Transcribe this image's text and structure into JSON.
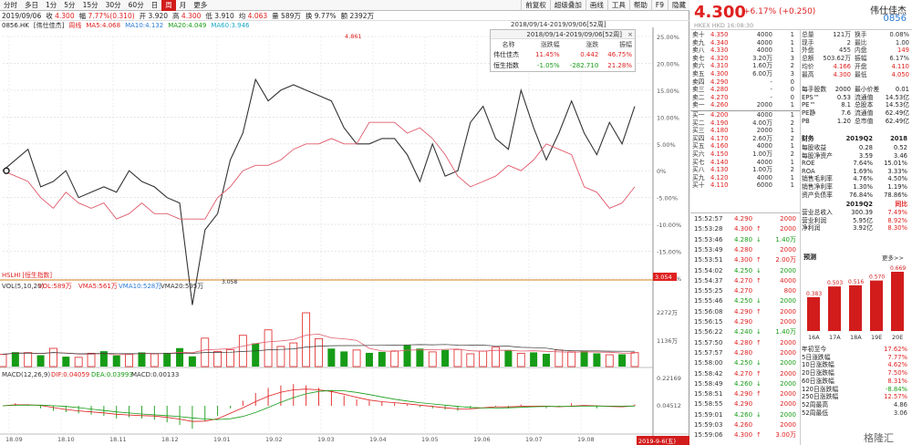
{
  "toolbar": {
    "tabs": [
      "分时",
      "多日",
      "1分",
      "5分",
      "15分",
      "30分",
      "60分",
      "日",
      "周",
      "月",
      "更多"
    ],
    "active": "周",
    "right": [
      "前复权",
      "超级叠加",
      "画线",
      "工具",
      "帮助",
      "F9",
      "隐藏"
    ]
  },
  "ohlc": {
    "date": "2019/09/06",
    "close_label": "收",
    "close": "4.300",
    "chg_label": "幅",
    "chg": "7.77%(0.310)",
    "open_label": "开",
    "open": "3.920",
    "high_label": "高",
    "high": "4.300",
    "low_label": "低",
    "low": "3.910",
    "avg_label": "均",
    "avg": "4.063",
    "vol_label": "量",
    "vol": "589万",
    "turn_label": "换",
    "turn": "9.77%",
    "amt_label": "额",
    "amt": "2392万"
  },
  "ma": {
    "code": "0856.HK",
    "name": "[伟仕佳杰]",
    "period": "周线",
    "ma5": "MA5:4.068",
    "ma10": "MA10:4.132",
    "ma20": "MA20:4.049",
    "ma60": "MA60:3.946"
  },
  "range_label": "2018/09/14-2019/09/06[52周]",
  "price_tag_top": "4.861",
  "price_tag_low": "3.058",
  "price_bar_right": "3.054",
  "index_label": "HSLHI [恒生指数]",
  "y_axis": [
    "25.00%",
    "20.00%",
    "15.00%",
    "10.00%",
    "5.00%",
    "0%",
    "-5.00%",
    "-10.00%",
    "-15.00%",
    "-20.00%"
  ],
  "overlay": {
    "title": "2018/09/14-2019/09/06[52周]",
    "headers": [
      "名称",
      "涨跌幅",
      "涨跌",
      "振幅"
    ],
    "rows": [
      [
        "伟仕佳杰",
        "11.45%",
        "0.442",
        "46.75%"
      ],
      [
        "恒生指数",
        "-1.05%",
        "-282.710",
        "21.28%"
      ]
    ]
  },
  "vol": {
    "label": "VOL(5,10,20)",
    "vol": "VOL:589万",
    "vma5": "VMA5:561万",
    "vma10": "VMA10:528万",
    "vma20": "VMA20:595万",
    "y": [
      "2272万",
      "1136万"
    ]
  },
  "macd": {
    "label": "MACD(12,26,9)",
    "dif": "DIF:0.04059",
    "dea": "DEA:0.03993",
    "macd": "MACD:0.00133",
    "y": [
      "0.22169",
      "0.04512"
    ]
  },
  "x_axis": [
    "18.09",
    "18.10",
    "18.11",
    "18.12",
    "19.01",
    "19.02",
    "19.03",
    "19.04",
    "19.05",
    "19.06",
    "19.07",
    "19.08"
  ],
  "x_end": "2019-9-6(五)",
  "chart_data": {
    "type": "line",
    "series": [
      {
        "name": "伟仕佳杰",
        "values": [
          0,
          2,
          4,
          -3,
          -2,
          0,
          -5,
          -4,
          -3,
          -4,
          0,
          -2,
          -3,
          -5,
          -6,
          -25,
          -11,
          -8,
          2,
          7,
          17,
          13,
          15,
          16,
          15,
          14,
          13,
          8,
          5,
          5,
          6,
          6,
          3,
          -2,
          5,
          -1,
          0,
          9,
          12,
          6,
          4,
          15,
          8,
          2,
          7,
          13,
          7,
          3,
          9,
          5,
          12
        ],
        "color": "#333333"
      },
      {
        "name": "恒生指数",
        "values": [
          0,
          -1,
          -2,
          -5,
          -7,
          -4,
          -6,
          -7,
          -6,
          -9,
          -8,
          -6,
          -8,
          -8,
          -9,
          -9,
          -9,
          -5,
          -3,
          0,
          1,
          1,
          2,
          4,
          5,
          5,
          6,
          5,
          5,
          9,
          9,
          9,
          7,
          8,
          6,
          3,
          -1,
          -3,
          -2,
          -1,
          1,
          0,
          2,
          5,
          4,
          3,
          -3,
          -4,
          -7,
          -6,
          -3
        ],
        "color": "#e05a6a"
      }
    ],
    "ylim": [
      -20,
      25
    ]
  },
  "vol_data": [
    520,
    610,
    590,
    480,
    770,
    420,
    390,
    560,
    650,
    470,
    520,
    600,
    540,
    580,
    780,
    430,
    1200,
    640,
    720,
    1320,
    980,
    1550,
    850,
    1000,
    2272,
    1180,
    760,
    640,
    700,
    580,
    620,
    660,
    900,
    760,
    620,
    700,
    720,
    540,
    650,
    820,
    700,
    560,
    600,
    540,
    700,
    620,
    650,
    560,
    500,
    520,
    589
  ],
  "vol_up": [
    1,
    0,
    1,
    0,
    1,
    0,
    1,
    1,
    0,
    0,
    1,
    0,
    1,
    0,
    0,
    0,
    1,
    1,
    1,
    1,
    0,
    1,
    1,
    1,
    1,
    1,
    0,
    0,
    1,
    0,
    0,
    1,
    0,
    0,
    1,
    0,
    1,
    1,
    1,
    1,
    0,
    1,
    0,
    0,
    1,
    1,
    0,
    0,
    1,
    0,
    1
  ],
  "macd_data": [
    0.0,
    0.02,
    0.01,
    -0.02,
    -0.04,
    -0.05,
    -0.06,
    -0.07,
    -0.08,
    -0.1,
    -0.09,
    -0.1,
    -0.11,
    -0.13,
    -0.15,
    -0.18,
    -0.12,
    -0.08,
    -0.02,
    0.04,
    0.1,
    0.14,
    0.16,
    0.17,
    0.16,
    0.14,
    0.12,
    0.08,
    0.05,
    0.04,
    0.03,
    0.02,
    0.01,
    -0.01,
    -0.02,
    -0.03,
    -0.04,
    -0.02,
    0.0,
    -0.01,
    -0.02,
    0.01,
    0.0,
    -0.02,
    -0.01,
    0.02,
    0.0,
    -0.02,
    0.0,
    -0.01,
    0.01
  ],
  "quote": {
    "price": "4.300",
    "change": "+6.17% (+0.250)",
    "name": "伟仕佳杰",
    "code": "0856",
    "market": "HKEX  HKD  16:08:30",
    "sells": [
      [
        "卖十",
        "4.350",
        "4000",
        "1"
      ],
      [
        "卖九",
        "4.340",
        "4000",
        "1"
      ],
      [
        "卖八",
        "4.330",
        "4000",
        "1"
      ],
      [
        "卖七",
        "4.320",
        "3.20万",
        "3"
      ],
      [
        "卖六",
        "4.310",
        "1.60万",
        "2"
      ],
      [
        "卖五",
        "4.300",
        "6.00万",
        "3"
      ],
      [
        "卖四",
        "4.290",
        "-",
        "0"
      ],
      [
        "卖三",
        "4.280",
        "-",
        "0"
      ],
      [
        "卖二",
        "4.270",
        "-",
        "0"
      ],
      [
        "卖一",
        "4.260",
        "2000",
        "1"
      ]
    ],
    "buys": [
      [
        "买一",
        "4.200",
        "4000",
        "1"
      ],
      [
        "买二",
        "4.190",
        "4.00万",
        "2"
      ],
      [
        "买三",
        "4.180",
        "2000",
        "1"
      ],
      [
        "买四",
        "4.170",
        "2.60万",
        "2"
      ],
      [
        "买五",
        "4.160",
        "4000",
        "1"
      ],
      [
        "买六",
        "4.150",
        "1.00万",
        "2"
      ],
      [
        "买七",
        "4.140",
        "4000",
        "1"
      ],
      [
        "买八",
        "4.130",
        "1.00万",
        "2"
      ],
      [
        "买九",
        "4.120",
        "4000",
        "1"
      ],
      [
        "买十",
        "4.110",
        "6000",
        "1"
      ]
    ],
    "stats": [
      [
        "总量",
        "121万",
        "换手",
        "0.08%"
      ],
      [
        "现手",
        "2",
        "最比",
        "1.00"
      ],
      [
        "外盘",
        "455",
        "内盘",
        "149"
      ],
      [
        "总额",
        "503.62万",
        "振幅",
        "6.17%"
      ],
      [
        "均价",
        "4.166",
        "开盘",
        "4.110"
      ],
      [
        "最高",
        "4.300",
        "最低",
        "4.050"
      ]
    ],
    "fund": [
      [
        "每手股数",
        "2000",
        "最小价差",
        "0.01"
      ],
      [
        "EPS™",
        "0.53",
        "流通值",
        "14.53亿"
      ],
      [
        "PE™",
        "8.1",
        "总股本",
        "14.53亿"
      ],
      [
        "PE静",
        "7.6",
        "流通值",
        "62.49亿"
      ],
      [
        "PB",
        "1.20",
        "总市值",
        "62.49亿"
      ]
    ],
    "fin_head": [
      "财务",
      "2019Q2",
      "2018"
    ],
    "fin": [
      [
        "每股收益",
        "0.28",
        "0.52"
      ],
      [
        "每股净资产",
        "3.59",
        "3.46"
      ],
      [
        "ROE",
        "7.64%",
        "15.01%"
      ],
      [
        "ROA",
        "1.69%",
        "3.33%"
      ],
      [
        "销售毛利率",
        "4.76%",
        "4.50%"
      ],
      [
        "销售净利率",
        "1.30%",
        "1.19%"
      ],
      [
        "资产负债率",
        "76.84%",
        "78.86%"
      ]
    ],
    "fin2_head": [
      "",
      "2019Q2",
      "同比"
    ],
    "fin2": [
      [
        "营业总收入",
        "300.39",
        "7.49%"
      ],
      [
        "营业利润",
        "5.95亿",
        "8.92%"
      ],
      [
        "净利润",
        "3.92亿",
        "8.30%"
      ]
    ],
    "forecast_label": "预测",
    "more": "更多>>",
    "forecast": {
      "years": [
        "16A",
        "17A",
        "18A",
        "19E",
        "20E"
      ],
      "values": [
        0.383,
        0.503,
        0.516,
        0.57,
        0.669
      ]
    },
    "perf": [
      [
        "年初至今",
        "17.62%"
      ],
      [
        "5日涨跌幅",
        "7.77%"
      ],
      [
        "10日涨跌幅",
        "4.62%"
      ],
      [
        "20日涨跌幅",
        "7.50%"
      ],
      [
        "60日涨跌幅",
        "8.31%"
      ],
      [
        "120日涨跌幅",
        "-8.84%"
      ],
      [
        "250日涨跌幅",
        "12.57%"
      ],
      [
        "52周最高",
        "4.86"
      ],
      [
        "52周最低",
        "3.06"
      ]
    ]
  },
  "ticks": [
    [
      "15:52:57",
      "4.290",
      "",
      "2000"
    ],
    [
      "15:53:28",
      "4.300",
      "↑",
      "2000"
    ],
    [
      "15:53:46",
      "4.280",
      "↓",
      "1.40万"
    ],
    [
      "15:53:49",
      "4.280",
      "",
      "2000"
    ],
    [
      "15:53:51",
      "4.300",
      "↑",
      "2.00万"
    ],
    [
      "15:54:02",
      "4.250",
      "↓",
      "2000"
    ],
    [
      "15:54:37",
      "4.270",
      "↑",
      "4000"
    ],
    [
      "15:55:25",
      "4.270",
      "",
      "800"
    ],
    [
      "15:55:46",
      "4.250",
      "↓",
      "2000"
    ],
    [
      "15:56:08",
      "4.290",
      "↑",
      "2000"
    ],
    [
      "15:56:15",
      "4.290",
      "",
      "2000"
    ],
    [
      "15:56:22",
      "4.240",
      "↓",
      "1.40万"
    ],
    [
      "15:57:50",
      "4.280",
      "↑",
      "2000"
    ],
    [
      "15:57:57",
      "4.280",
      "",
      "2000"
    ],
    [
      "15:58:00",
      "4.250",
      "↓",
      "2000"
    ],
    [
      "15:58:42",
      "4.270",
      "↑",
      "2000"
    ],
    [
      "15:58:49",
      "4.260",
      "↓",
      "2000"
    ],
    [
      "15:58:51",
      "4.290",
      "↑",
      "2000"
    ],
    [
      "15:58:55",
      "4.290",
      "",
      "2000"
    ],
    [
      "15:59:01",
      "4.260",
      "↓",
      "2000"
    ],
    [
      "15:59:03",
      "4.260",
      "",
      "2000"
    ],
    [
      "15:59:06",
      "4.300",
      "↑",
      "3.00万"
    ]
  ],
  "watermark": "格隆汇",
  "colors": {
    "up": "#e02020",
    "down": "#169c16",
    "accent": "#d21c1c"
  }
}
